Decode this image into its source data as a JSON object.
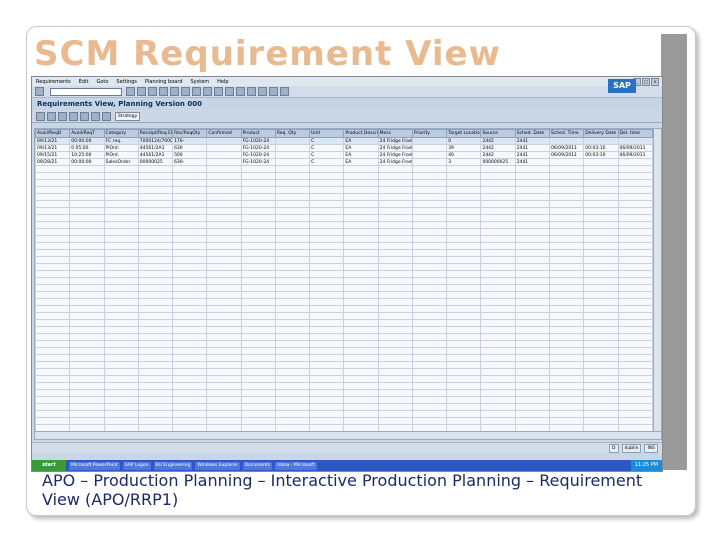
{
  "slide": {
    "title": "SCM Requirement View",
    "caption": "APO – Production Planning – Interactive Production Planning – Requirement View (APO/RRP1)"
  },
  "sap": {
    "menu": [
      "Requirements",
      "Edit",
      "Goto",
      "Settings",
      "Planning board",
      "System",
      "Help"
    ],
    "logo": "SAP",
    "screen_title": "Requirements View, Planning Version 000",
    "strategy_label": "Strategy",
    "columns": [
      "Avail/ReqD",
      "Avail/ReqT",
      "Category",
      "Receipt/Req Elt",
      "Rec/ReqQty",
      "Confirmed",
      "Product",
      "Req. Qty",
      "Unit",
      "Product Descript.",
      "Mess",
      "Priority",
      "Target Location",
      "Source",
      "Sched. Date",
      "Sched. Time",
      "Delivery Date",
      "Del. time"
    ],
    "rows": [
      [
        "09/13/21",
        "00:00:00",
        "FC req.",
        "7000124/7000124",
        "176-",
        "",
        "FG-1020-24",
        "",
        "C",
        "EA",
        "24 Fridge Frost Std",
        "",
        "0",
        "2442",
        "2441",
        "",
        "",
        ""
      ],
      [
        "09/13/21",
        "0 05:00",
        "PlOrd.",
        "44561/2A1",
        "630",
        "",
        "FG-1020-24",
        "",
        "C",
        "EA",
        "24 Fridge Frost Std",
        "",
        "39",
        "2442",
        "2441",
        "06/09/2011",
        "00:03:10",
        "06/09/2011"
      ],
      [
        "09/15/21",
        "10:25:00",
        "PlOrd.",
        "44561/2A1",
        "500",
        "",
        "FG-1020-24",
        "",
        "C",
        "EA",
        "24 Fridge Frost Std",
        "",
        "40",
        "2442",
        "2441",
        "06/09/2011",
        "00:03:10",
        "06/09/2011"
      ],
      [
        "09/28/21",
        "00:00:00",
        "SalesOrder",
        "00000025",
        "630-",
        "",
        "FG-1020-24",
        "",
        "C",
        "EA",
        "24 Fridge Frost Std",
        "",
        "3",
        "000000025",
        "2441",
        "",
        "",
        ""
      ]
    ],
    "status_items": [
      "D",
      "dublin",
      "INS"
    ],
    "taskbar": {
      "start": "start",
      "items": [
        "Microsoft PowerPoint",
        "SAP Logon",
        "BU Engineering",
        "Windows Explorer",
        "Documents",
        "Inbox - Microsoft"
      ],
      "clock": "11:25 PM"
    }
  }
}
